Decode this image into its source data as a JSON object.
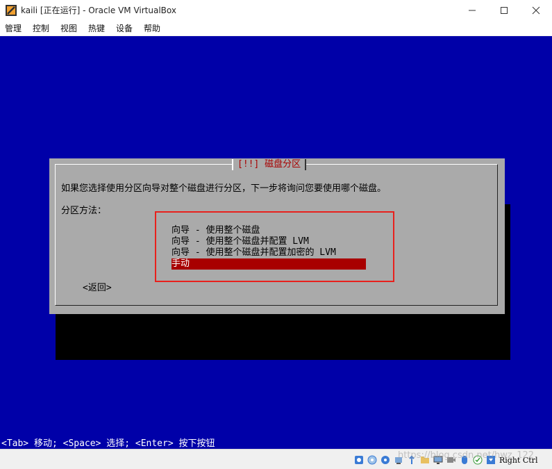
{
  "window": {
    "title": "kaili [正在运行] - Oracle VM VirtualBox",
    "minimize_icon": "minimize-icon",
    "maximize_icon": "maximize-icon",
    "close_icon": "close-icon"
  },
  "menu": [
    "管理",
    "控制",
    "视图",
    "热键",
    "设备",
    "帮助"
  ],
  "dialog": {
    "title": "[!!] 磁盘分区",
    "question": "如果您选择使用分区向导对整个磁盘进行分区，下一步将询问您要使用哪个磁盘。",
    "method_label": "分区方法：",
    "options": [
      "向导 - 使用整个磁盘",
      "向导 - 使用整个磁盘并配置 LVM",
      "向导 - 使用整个磁盘并配置加密的 LVM",
      "手动"
    ],
    "selected_option": "手动",
    "back_button": "<返回>"
  },
  "hint": "<Tab> 移动; <Space> 选择; <Enter> 按下按钮",
  "statusbar": {
    "host_key": "Right Ctrl",
    "icons": [
      "hard-disk-icon",
      "optical-drive-icon",
      "audio-icon",
      "network-icon",
      "usb-icon",
      "shared-folder-icon",
      "display-icon",
      "recording-icon",
      "mouse-integration-icon",
      "keyboard-icon",
      "arrow-down-icon"
    ]
  },
  "watermark": "https://blog.csdn.net/hwz_122",
  "colors": {
    "screen_bg": "#0000a8",
    "dialog_bg": "#aaaaaa",
    "title_text": "#a80000",
    "selection_bg": "#a80000",
    "annotation_box": "#e8201c"
  }
}
